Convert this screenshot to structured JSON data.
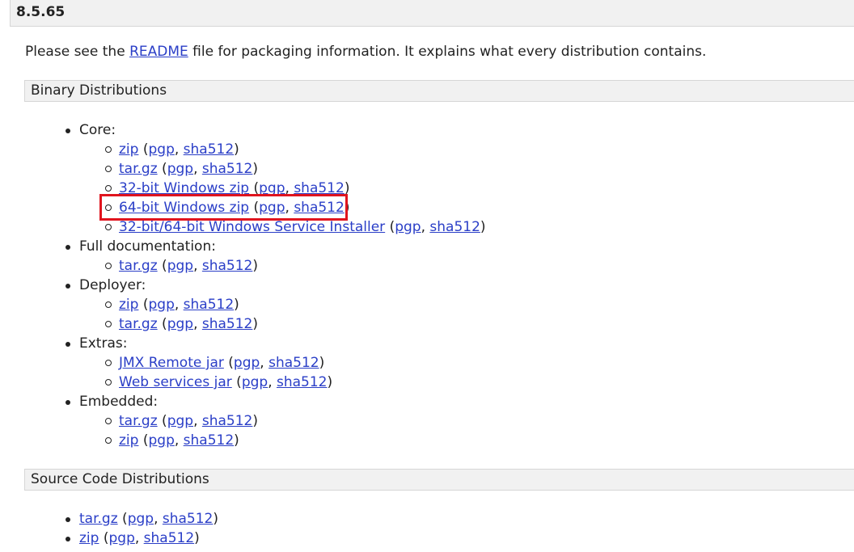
{
  "version": {
    "title": "8.5.65"
  },
  "intro": {
    "before": "Please see the ",
    "link": "README",
    "after": " file for packaging information. It explains what every distribution contains."
  },
  "binary": {
    "title": "Binary Distributions",
    "categories": [
      {
        "label": "Core:",
        "items": [
          {
            "name": "zip",
            "pgp": "pgp",
            "sha": "sha512"
          },
          {
            "name": "tar.gz",
            "pgp": "pgp",
            "sha": "sha512"
          },
          {
            "name": "32-bit Windows zip",
            "pgp": "pgp",
            "sha": "sha512"
          },
          {
            "name": "64-bit Windows zip",
            "pgp": "pgp",
            "sha": "sha512"
          },
          {
            "name": "32-bit/64-bit Windows Service Installer",
            "pgp": "pgp",
            "sha": "sha512"
          }
        ]
      },
      {
        "label": "Full documentation:",
        "items": [
          {
            "name": "tar.gz",
            "pgp": "pgp",
            "sha": "sha512"
          }
        ]
      },
      {
        "label": "Deployer:",
        "items": [
          {
            "name": "zip",
            "pgp": "pgp",
            "sha": "sha512"
          },
          {
            "name": "tar.gz",
            "pgp": "pgp",
            "sha": "sha512"
          }
        ]
      },
      {
        "label": "Extras:",
        "items": [
          {
            "name": "JMX Remote jar",
            "pgp": "pgp",
            "sha": "sha512"
          },
          {
            "name": "Web services jar",
            "pgp": "pgp",
            "sha": "sha512"
          }
        ]
      },
      {
        "label": "Embedded:",
        "items": [
          {
            "name": "tar.gz",
            "pgp": "pgp",
            "sha": "sha512"
          },
          {
            "name": "zip",
            "pgp": "pgp",
            "sha": "sha512"
          }
        ]
      }
    ]
  },
  "source": {
    "title": "Source Code Distributions",
    "items": [
      {
        "name": "tar.gz",
        "pgp": "pgp",
        "sha": "sha512"
      },
      {
        "name": "zip",
        "pgp": "pgp",
        "sha": "sha512"
      }
    ]
  },
  "punct": {
    "open": " (",
    "comma": ", ",
    "close": ")"
  },
  "colors": {
    "link": "#2a3ec7",
    "highlight": "#e0141e",
    "header_bg": "#f1f1f1"
  }
}
